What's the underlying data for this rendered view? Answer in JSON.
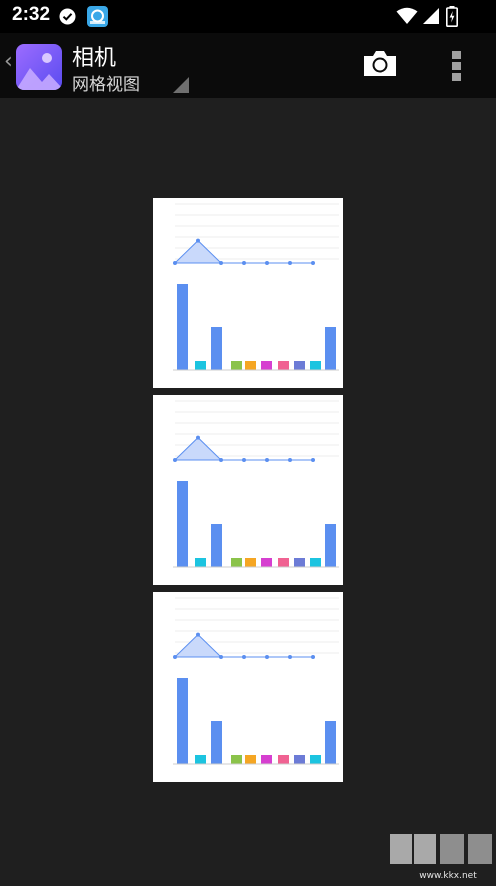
{
  "status_bar": {
    "time": "2:32"
  },
  "app_bar": {
    "title": "相机",
    "subtitle": "网格视图"
  },
  "thumbnail_count": 3,
  "thumbnail_chart": {
    "line_y": [
      0,
      0.8,
      0,
      0,
      0,
      0,
      0
    ],
    "bar_values": [
      2,
      0,
      1,
      0,
      0,
      0,
      0,
      0,
      0,
      1
    ],
    "bar_colors": [
      "#5b8ff0",
      "#1cc4e0",
      "#5b8ff0",
      "#8bc34a",
      "#f5a623",
      "#d63fd0",
      "#f06292",
      "#6c7bd6",
      "#1cc4e0",
      "#5b8ff0"
    ]
  },
  "watermark": {
    "brand": "KK下载",
    "url": "www.kkx.net"
  },
  "colors": {
    "background": "#1f1f1f",
    "appbar": "#0b0b0b",
    "chart_blue": "#5b8ff0"
  }
}
